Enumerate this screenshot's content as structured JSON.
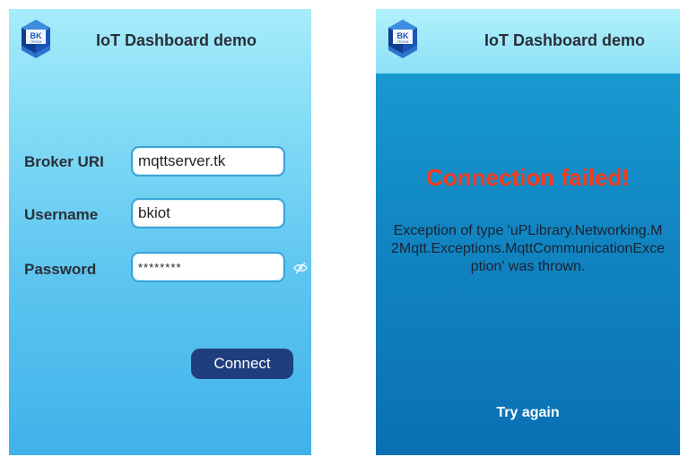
{
  "app": {
    "title": "IoT Dashboard demo",
    "logo_text": "BK",
    "logo_subtext": "TP.HCM"
  },
  "login": {
    "broker_label": "Broker URI",
    "broker_value": "mqttserver.tk",
    "username_label": "Username",
    "username_value": "bkiot",
    "password_label": "Password",
    "password_value": "********",
    "password_toggle_icon": "eye-slash-icon",
    "connect_label": "Connect"
  },
  "error": {
    "title": "Connection failed!",
    "message": "Exception of type 'uPLibrary.Networking.M2Mqtt.Exceptions.MqttCommunicationException' was thrown.",
    "try_again_label": "Try again"
  },
  "colors": {
    "accent": "#1f3e7c",
    "error": "#ff3a1b",
    "input_border": "#3aa3d8"
  }
}
